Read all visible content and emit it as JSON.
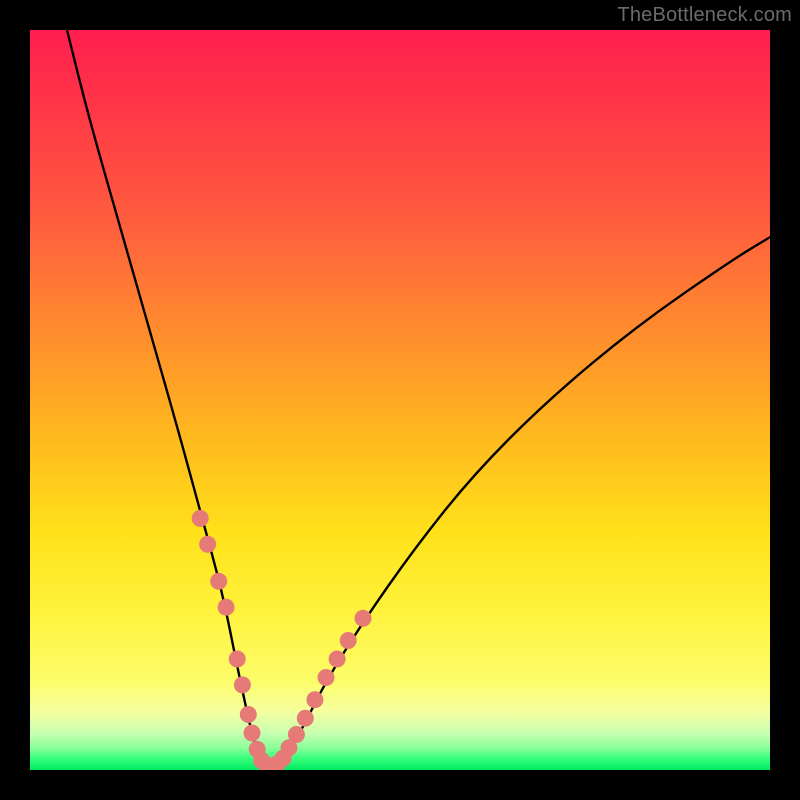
{
  "watermark": "TheBottleneck.com",
  "chart_data": {
    "type": "line",
    "title": "",
    "xlabel": "",
    "ylabel": "",
    "xlim": [
      0,
      100
    ],
    "ylim": [
      0,
      100
    ],
    "series": [
      {
        "name": "bottleneck-curve",
        "x": [
          5,
          8,
          12,
          16,
          20,
          23,
          26,
          28,
          29.5,
          30.5,
          32,
          33.5,
          35,
          37,
          40,
          45,
          52,
          60,
          70,
          82,
          95,
          100
        ],
        "values": [
          100,
          88,
          74,
          60,
          46,
          35,
          24,
          14,
          7,
          3,
          0.5,
          0.5,
          2.5,
          6,
          12,
          20,
          30,
          40,
          50,
          60,
          69,
          72
        ]
      }
    ],
    "markers": {
      "name": "highlight-dots",
      "color": "#e57a77",
      "points": [
        {
          "x": 23.0,
          "y": 34.0
        },
        {
          "x": 24.0,
          "y": 30.5
        },
        {
          "x": 25.5,
          "y": 25.5
        },
        {
          "x": 26.5,
          "y": 22.0
        },
        {
          "x": 28.0,
          "y": 15.0
        },
        {
          "x": 28.7,
          "y": 11.5
        },
        {
          "x": 29.5,
          "y": 7.5
        },
        {
          "x": 30.0,
          "y": 5.0
        },
        {
          "x": 30.7,
          "y": 2.8
        },
        {
          "x": 31.3,
          "y": 1.3
        },
        {
          "x": 32.0,
          "y": 0.6
        },
        {
          "x": 32.8,
          "y": 0.6
        },
        {
          "x": 33.5,
          "y": 0.9
        },
        {
          "x": 34.2,
          "y": 1.6
        },
        {
          "x": 35.0,
          "y": 3.0
        },
        {
          "x": 36.0,
          "y": 4.8
        },
        {
          "x": 37.2,
          "y": 7.0
        },
        {
          "x": 38.5,
          "y": 9.5
        },
        {
          "x": 40.0,
          "y": 12.5
        },
        {
          "x": 41.5,
          "y": 15.0
        },
        {
          "x": 43.0,
          "y": 17.5
        },
        {
          "x": 45.0,
          "y": 20.5
        }
      ]
    },
    "gradient_stops": [
      {
        "pos": 0.0,
        "color": "#ff1e4e"
      },
      {
        "pos": 0.4,
        "color": "#ff8a2e"
      },
      {
        "pos": 0.7,
        "color": "#ffe11a"
      },
      {
        "pos": 0.92,
        "color": "#f5ff9e"
      },
      {
        "pos": 1.0,
        "color": "#00e863"
      }
    ]
  }
}
